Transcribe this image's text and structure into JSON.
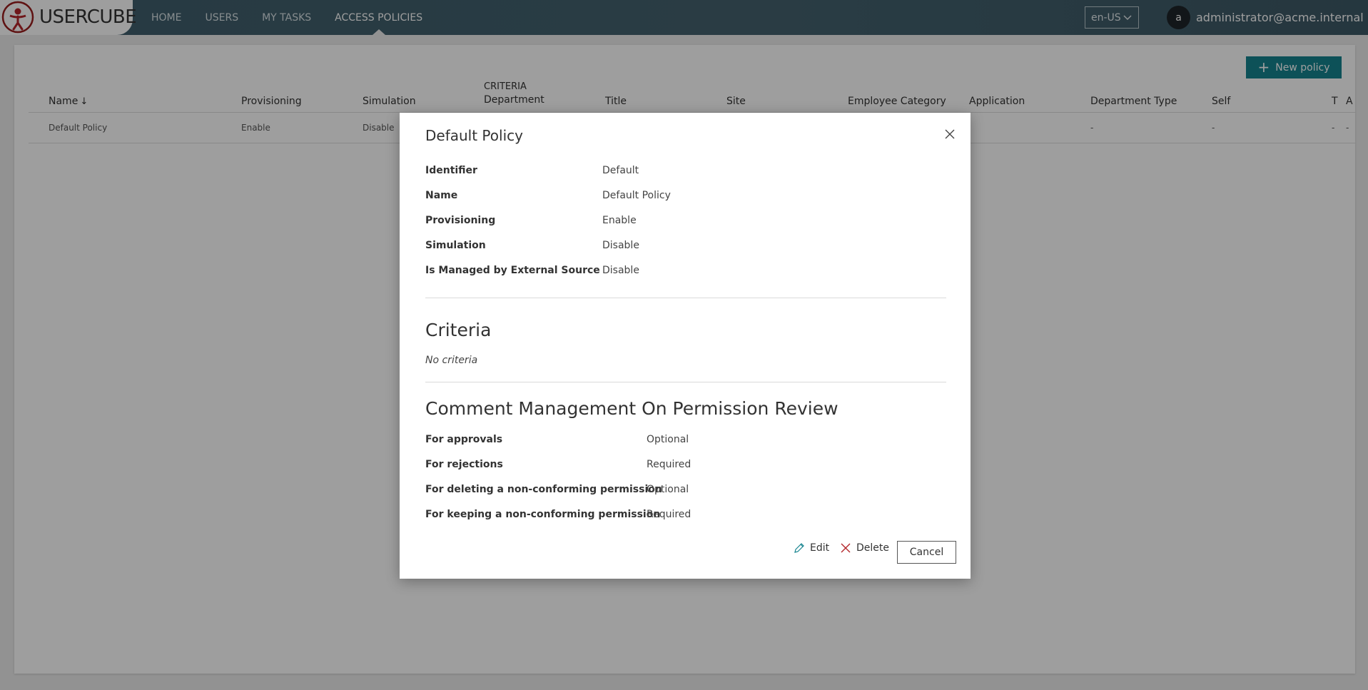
{
  "app": {
    "logo_text": "USERCUBE",
    "nav": [
      {
        "label": "HOME"
      },
      {
        "label": "USERS"
      },
      {
        "label": "MY TASKS"
      },
      {
        "label": "ACCESS POLICIES",
        "active": true
      }
    ],
    "language": "en-US",
    "user": {
      "initial": "a",
      "name": "administrator@acme.internal"
    }
  },
  "page": {
    "new_button_label": "New policy",
    "table": {
      "criteria_group_label": "CRITERIA",
      "columns": [
        "Name",
        "Provisioning",
        "Simulation",
        "Department",
        "Title",
        "Site",
        "Employee Category",
        "Application",
        "Department Type",
        "Self",
        "T",
        "A"
      ],
      "sort_indicator": "↓",
      "rows": [
        [
          "Default Policy",
          "Enable",
          "Disable",
          "",
          "",
          "",
          "",
          "",
          "-",
          "-",
          "-",
          "-"
        ]
      ]
    }
  },
  "modal": {
    "title": "Default Policy",
    "properties": [
      {
        "label": "Identifier",
        "value": "Default"
      },
      {
        "label": "Name",
        "value": "Default Policy"
      },
      {
        "label": "Provisioning",
        "value": "Enable"
      },
      {
        "label": "Simulation",
        "value": "Disable"
      },
      {
        "label": "Is Managed by External Source",
        "value": "Disable"
      }
    ],
    "criteria": {
      "title": "Criteria",
      "empty_text": "No criteria"
    },
    "comments": {
      "title": "Comment Management On Permission Review",
      "items": [
        {
          "label": "For approvals",
          "value": "Optional"
        },
        {
          "label": "For rejections",
          "value": "Required"
        },
        {
          "label": "For deleting a non-conforming permission",
          "value": "Optional"
        },
        {
          "label": "For keeping a non-conforming permission",
          "value": "Required"
        }
      ]
    },
    "actions": {
      "edit": "Edit",
      "delete": "Delete",
      "cancel": "Cancel"
    }
  },
  "colors": {
    "accent": "#15838e",
    "navbar": "#44626f"
  }
}
